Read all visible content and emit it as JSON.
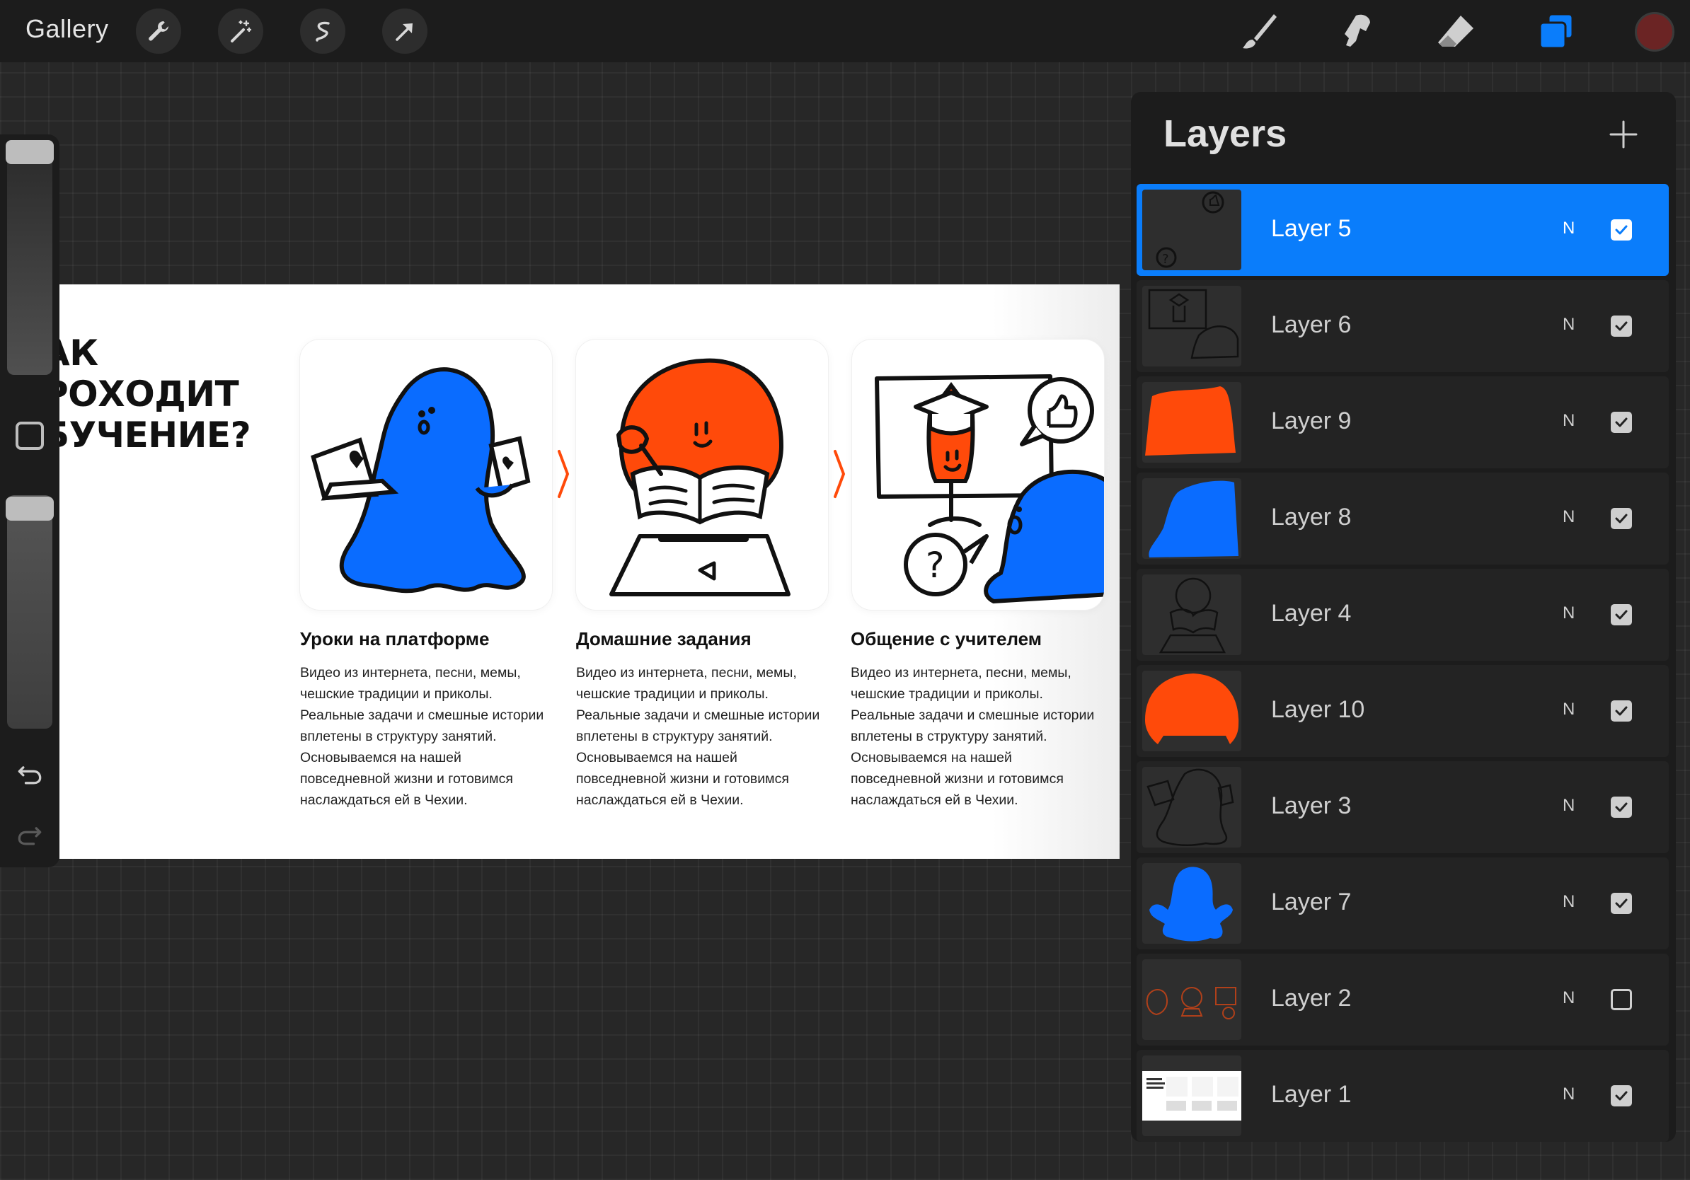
{
  "toolbar": {
    "gallery_label": "Gallery",
    "left_tools": [
      "wrench-icon",
      "magic-wand-icon",
      "selection-icon",
      "transform-arrow-icon"
    ],
    "right_tools": [
      "brush-icon",
      "smudge-icon",
      "eraser-icon",
      "layers-icon"
    ],
    "active_color": "#6b2424"
  },
  "sidebar": {
    "controls": [
      "brush-size-slider",
      "modify-button",
      "opacity-slider",
      "undo-icon",
      "redo-icon"
    ]
  },
  "artwork": {
    "headline": [
      "АК",
      "РОХОДИТ",
      "БУЧЕНИЕ?"
    ],
    "accent_blue": "#0a6cff",
    "accent_orange": "#ff4a0a",
    "steps": [
      {
        "title": "Уроки на платформе",
        "description": "Видео из интернета, песни, мемы, чешские традиции и приколы. Реальные задачи и смешные истории вплетены в структуру занятий. Основываемся на нашей повседневной жизни и готовимся наслаждаться ей в Чехии."
      },
      {
        "title": "Домашние задания",
        "description": "Видео из интернета, песни, мемы, чешские традиции и приколы. Реальные задачи и смешные истории вплетены в структуру занятий. Основываемся на нашей повседневной жизни и готовимся наслаждаться ей в Чехии."
      },
      {
        "title": "Общение с учителем",
        "description": "Видео из интернета, песни, мемы, чешские традиции и приколы. Реальные задачи и смешные истории вплетены в структуру занятий. Основываемся на нашей повседневной жизни и готовимся наслаждаться ей в Чехии."
      }
    ]
  },
  "layers": {
    "title": "Layers",
    "add_icon": "plus-icon",
    "active_color": "#0a7dfb",
    "items": [
      {
        "name": "Layer 5",
        "blend": "N",
        "visible": true,
        "active": true
      },
      {
        "name": "Layer 6",
        "blend": "N",
        "visible": true,
        "active": false
      },
      {
        "name": "Layer 9",
        "blend": "N",
        "visible": true,
        "active": false
      },
      {
        "name": "Layer 8",
        "blend": "N",
        "visible": true,
        "active": false
      },
      {
        "name": "Layer 4",
        "blend": "N",
        "visible": true,
        "active": false
      },
      {
        "name": "Layer 10",
        "blend": "N",
        "visible": true,
        "active": false
      },
      {
        "name": "Layer 3",
        "blend": "N",
        "visible": true,
        "active": false
      },
      {
        "name": "Layer 7",
        "blend": "N",
        "visible": true,
        "active": false
      },
      {
        "name": "Layer 2",
        "blend": "N",
        "visible": false,
        "active": false
      },
      {
        "name": "Layer 1",
        "blend": "N",
        "visible": true,
        "active": false
      }
    ]
  }
}
